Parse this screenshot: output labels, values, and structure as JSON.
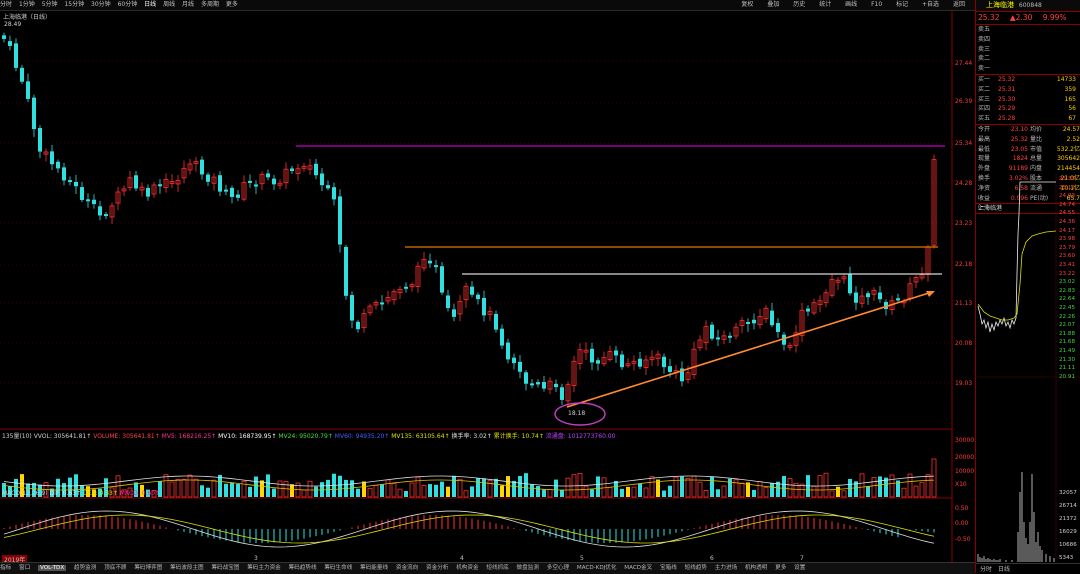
{
  "toolbar": {
    "periods": [
      "分时",
      "1分钟",
      "5分钟",
      "15分钟",
      "30分钟",
      "60分钟",
      "日线",
      "周线",
      "月线",
      "多周期",
      "更多"
    ],
    "active_period": "日线",
    "right_tools": [
      "复权",
      "叠加",
      "历史",
      "统计",
      "画线",
      "F10",
      "标记",
      "+自选",
      "返回"
    ]
  },
  "main": {
    "title": "上海临港（日线）",
    "top_price_label": "28.49",
    "low_marker": "18.18",
    "price_axis": [
      "27.44",
      "26.39",
      "25.34",
      "24.28",
      "23.23",
      "22.18",
      "21.13",
      "20.08",
      "19.03"
    ],
    "levels": {
      "magenta": "25.34",
      "orange": "22.60",
      "white": "21.86"
    }
  },
  "volume": {
    "label_name": "135量(10)",
    "vvol": "VVOL: 305641.81↑",
    "volume": "VOLUME: 305641.81↑",
    "mv5": "MV5: 168216.25↑",
    "mv10": "MV10: 168739.95↑",
    "mv24": "MV24: 95020.79↑",
    "mv60": "MV60: 94935.20↑",
    "mv135": "MV135: 63105.64↑",
    "turnover": "换手率: 3.02↑",
    "cum_turnover": "累计换手: 10.74↑",
    "float_shares": "流通盘: 1012773760.00",
    "axis": [
      "30000",
      "20000",
      "10000"
    ],
    "unit": "X10"
  },
  "macd": {
    "label": "MACD(12,26,9)",
    "dif": "DIF: 0.63↑",
    "dea": "DEA: 0.33↑",
    "macd": "MACD: 0.60↑",
    "axis": [
      "0.50",
      "0.00",
      "-0.50"
    ]
  },
  "x_axis": [
    "2019年",
    "3",
    "4",
    "5",
    "6",
    "7"
  ],
  "bottom_tabs": [
    "指标",
    "窗口",
    "VOL-TDX",
    "趋势监测",
    "顶底不顾",
    "筹码博弈图",
    "筹码波段主图",
    "筹码战宝图",
    "筹码主力资金",
    "筹码趋势线",
    "筹码生命线",
    "筹码能量线",
    "资金流向",
    "资金分析",
    "机构资金",
    "短线抓底",
    "做盘监测",
    "多空心理",
    "MACD-KDJ优化",
    "MACD金叉",
    "宝箱线",
    "短线趋势",
    "主力进场",
    "机构透明",
    "更多",
    "设置"
  ],
  "quote": {
    "name": "上海临港",
    "code": "600848",
    "price": "25.32",
    "change": "▲2.30",
    "pct": "9.99%",
    "sells": [
      {
        "n": "卖五",
        "p": "",
        "v": ""
      },
      {
        "n": "卖四",
        "p": "",
        "v": ""
      },
      {
        "n": "卖三",
        "p": "",
        "v": ""
      },
      {
        "n": "卖二",
        "p": "",
        "v": ""
      },
      {
        "n": "卖一",
        "p": "",
        "v": ""
      }
    ],
    "buys": [
      {
        "n": "买一",
        "p": "25.32",
        "v": "14733"
      },
      {
        "n": "买二",
        "p": "25.31",
        "v": "359"
      },
      {
        "n": "买三",
        "p": "25.30",
        "v": "165"
      },
      {
        "n": "买四",
        "p": "25.29",
        "v": "56"
      },
      {
        "n": "买五",
        "p": "25.28",
        "v": "67"
      }
    ],
    "stats": [
      [
        "今开",
        "23.10",
        "均价",
        "24.57"
      ],
      [
        "最高",
        "25.32",
        "量比",
        "2.52"
      ],
      [
        "最低",
        "23.05",
        "市值",
        "532.2亿"
      ],
      [
        "现量",
        "1824",
        "总量",
        "305642"
      ],
      [
        "外盘",
        "91189",
        "内盘",
        "214454"
      ],
      [
        "换手",
        "3.02%",
        "股本",
        "21.0亿"
      ],
      [
        "净资",
        "6.58",
        "流通",
        "10.1亿"
      ],
      [
        "收益(一)",
        "0.096",
        "PE(动)",
        "65.7"
      ]
    ],
    "mini_title": "上海临港",
    "mini_price_axis": [
      "25.33",
      "25.12",
      "24.93",
      "24.74",
      "24.55",
      "24.36",
      "24.17",
      "23.98",
      "23.79",
      "23.60",
      "23.41",
      "23.22",
      "23.02",
      "22.83",
      "22.64",
      "22.45",
      "22.26",
      "22.07",
      "21.88",
      "21.68",
      "21.49",
      "21.30",
      "21.11",
      "20.91"
    ],
    "mini_vol_axis": [
      "32057",
      "26714",
      "21372",
      "16029",
      "10686",
      "5343"
    ],
    "bottom_tabs": [
      "分时",
      "日线"
    ]
  }
}
